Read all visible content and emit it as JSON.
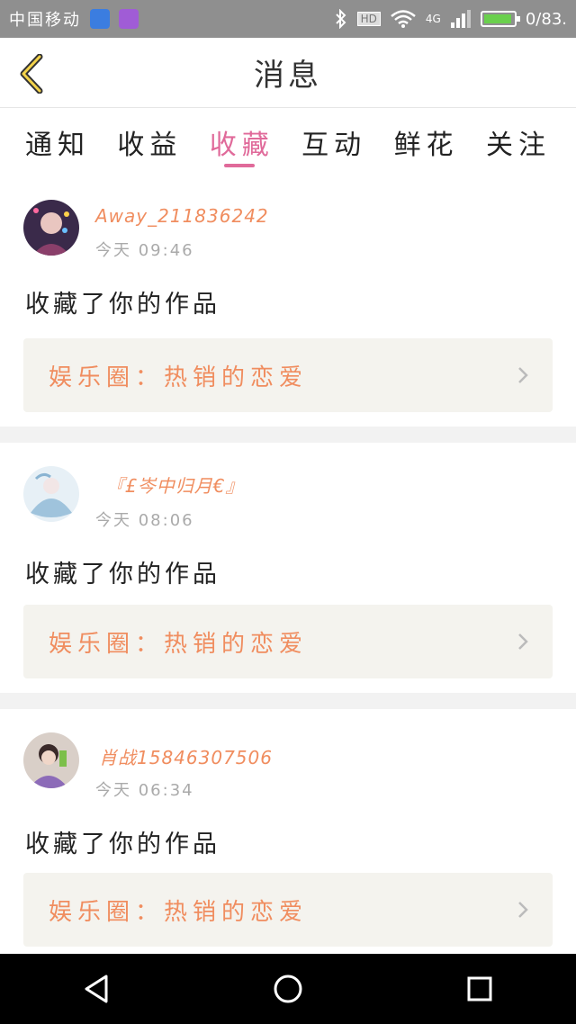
{
  "status": {
    "carrier": "中国移动",
    "right_text": "0/83.",
    "hd": "HD",
    "net": "4G"
  },
  "header": {
    "title": "消息"
  },
  "tabs": [
    {
      "label": "通知",
      "active": false
    },
    {
      "label": "收益",
      "active": false
    },
    {
      "label": "收藏",
      "active": true
    },
    {
      "label": "互动",
      "active": false
    },
    {
      "label": "鲜花",
      "active": false
    },
    {
      "label": "关注",
      "active": false
    }
  ],
  "messages": [
    {
      "user": "Away_211836242",
      "time": "今天 09:46",
      "action": "收藏了你的作品",
      "work": "娱乐圈：热销的恋爱"
    },
    {
      "user": "『£岑中归月€』",
      "time": "今天 08:06",
      "action": "收藏了你的作品",
      "work": "娱乐圈：热销的恋爱"
    },
    {
      "user": "肖战15846307506",
      "time": "今天 06:34",
      "action": "收藏了你的作品",
      "work": "娱乐圈：热销的恋爱"
    }
  ],
  "colors": {
    "accent": "#e06a9a",
    "orange": "#f08d5f"
  }
}
